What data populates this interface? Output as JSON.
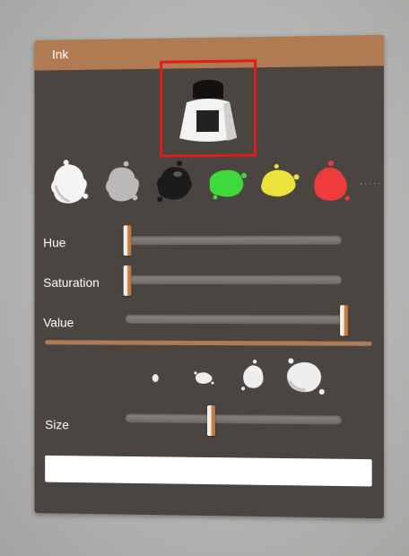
{
  "panel": {
    "title": "Ink"
  },
  "ink_preview": {
    "icon": "ink-bottle-icon",
    "selected": true,
    "highlight_color": "#e21b1b"
  },
  "palette": {
    "swatches": [
      {
        "name": "white",
        "color": "#f4f4f4"
      },
      {
        "name": "light-gray",
        "color": "#b9b9b9"
      },
      {
        "name": "black",
        "color": "#1b1b1b"
      },
      {
        "name": "green",
        "color": "#3ed93a"
      },
      {
        "name": "yellow",
        "color": "#ece33a"
      },
      {
        "name": "red",
        "color": "#ef3b3b"
      }
    ],
    "more_indicator": "·····"
  },
  "color": {
    "hue": {
      "label": "Hue",
      "value": 0.0
    },
    "saturation": {
      "label": "Saturation",
      "value": 0.0
    },
    "value": {
      "label": "Value",
      "value": 1.0
    }
  },
  "brush": {
    "presets": [
      "brush-size-1-icon",
      "brush-size-2-icon",
      "brush-size-3-icon",
      "brush-size-4-icon"
    ],
    "size": {
      "label": "Size",
      "value": 0.4
    }
  },
  "text_input": {
    "value": ""
  },
  "colors": {
    "accent": "#b07b52",
    "panel_bg": "#4a4541",
    "highlight": "#e21b1b"
  }
}
